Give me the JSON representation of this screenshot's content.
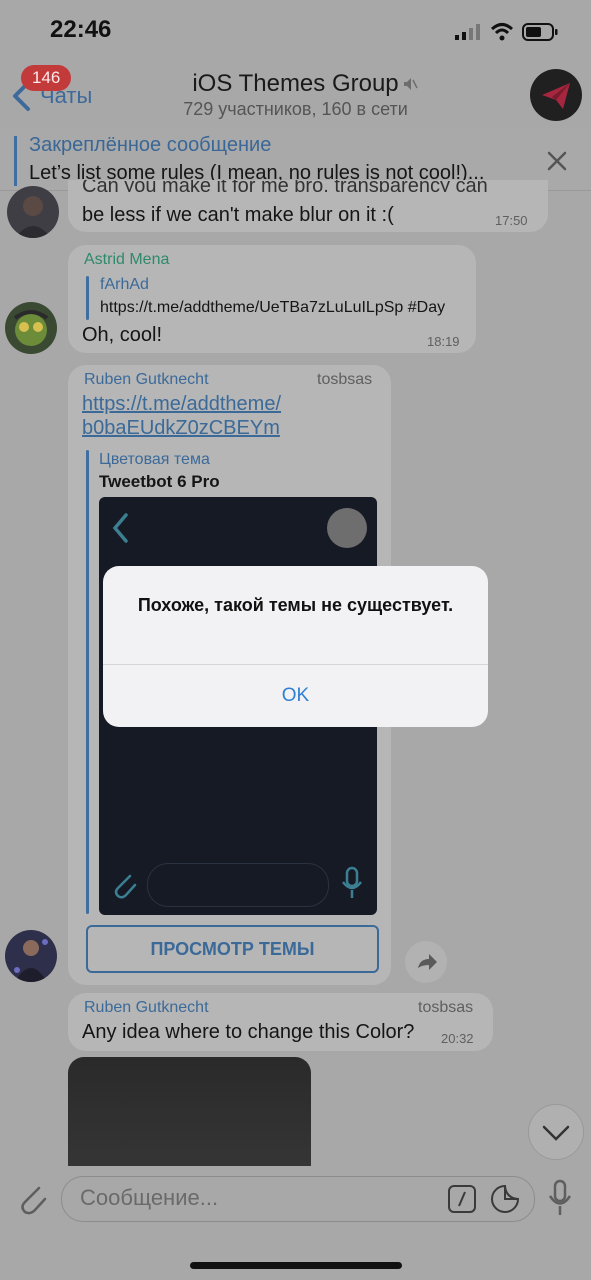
{
  "status_bar": {
    "time": "22:46"
  },
  "header": {
    "back_label": "Чаты",
    "badge_count": "146",
    "title": "iOS Themes Group",
    "subtitle": "729 участников, 160 в сети"
  },
  "pinned": {
    "title": "Закреплённое сообщение",
    "text": "Let’s list some rules (I mean, no rules is not cool!)..."
  },
  "messages": [
    {
      "text_line1": "Can you make it for me bro, transparency can",
      "text_line2": "be less if we can't make blur on it :(",
      "time": "17:50"
    },
    {
      "sender": "Astrid Mena",
      "reply_name": "fArhAd",
      "reply_text": "https://t.me/addtheme/UeTBa7zLuLuILpSp #Day",
      "text": "Oh, cool!",
      "time": "18:19"
    },
    {
      "sender": "Ruben Gutknecht",
      "tag": "tosbsas",
      "link_line1": "https://t.me/addtheme/",
      "link_line2": "b0baEUdkZ0zCBEYm",
      "preview_label": "Цветовая тема",
      "preview_title": "Tweetbot 6 Pro",
      "button_label": "ПРОСМОТР ТЕМЫ"
    },
    {
      "sender": "Ruben Gutknecht",
      "tag": "tosbsas",
      "text": "Any idea where to change this Color?",
      "time": "20:32"
    }
  ],
  "dialog": {
    "message": "Похоже, такой темы не существует.",
    "ok_label": "OK"
  },
  "input": {
    "placeholder": "Сообщение..."
  },
  "colors": {
    "accent": "#2f7fd2",
    "dim_link": "#3b6a99",
    "green_sender": "#2e8a6a",
    "badge": "#c23a3a"
  }
}
